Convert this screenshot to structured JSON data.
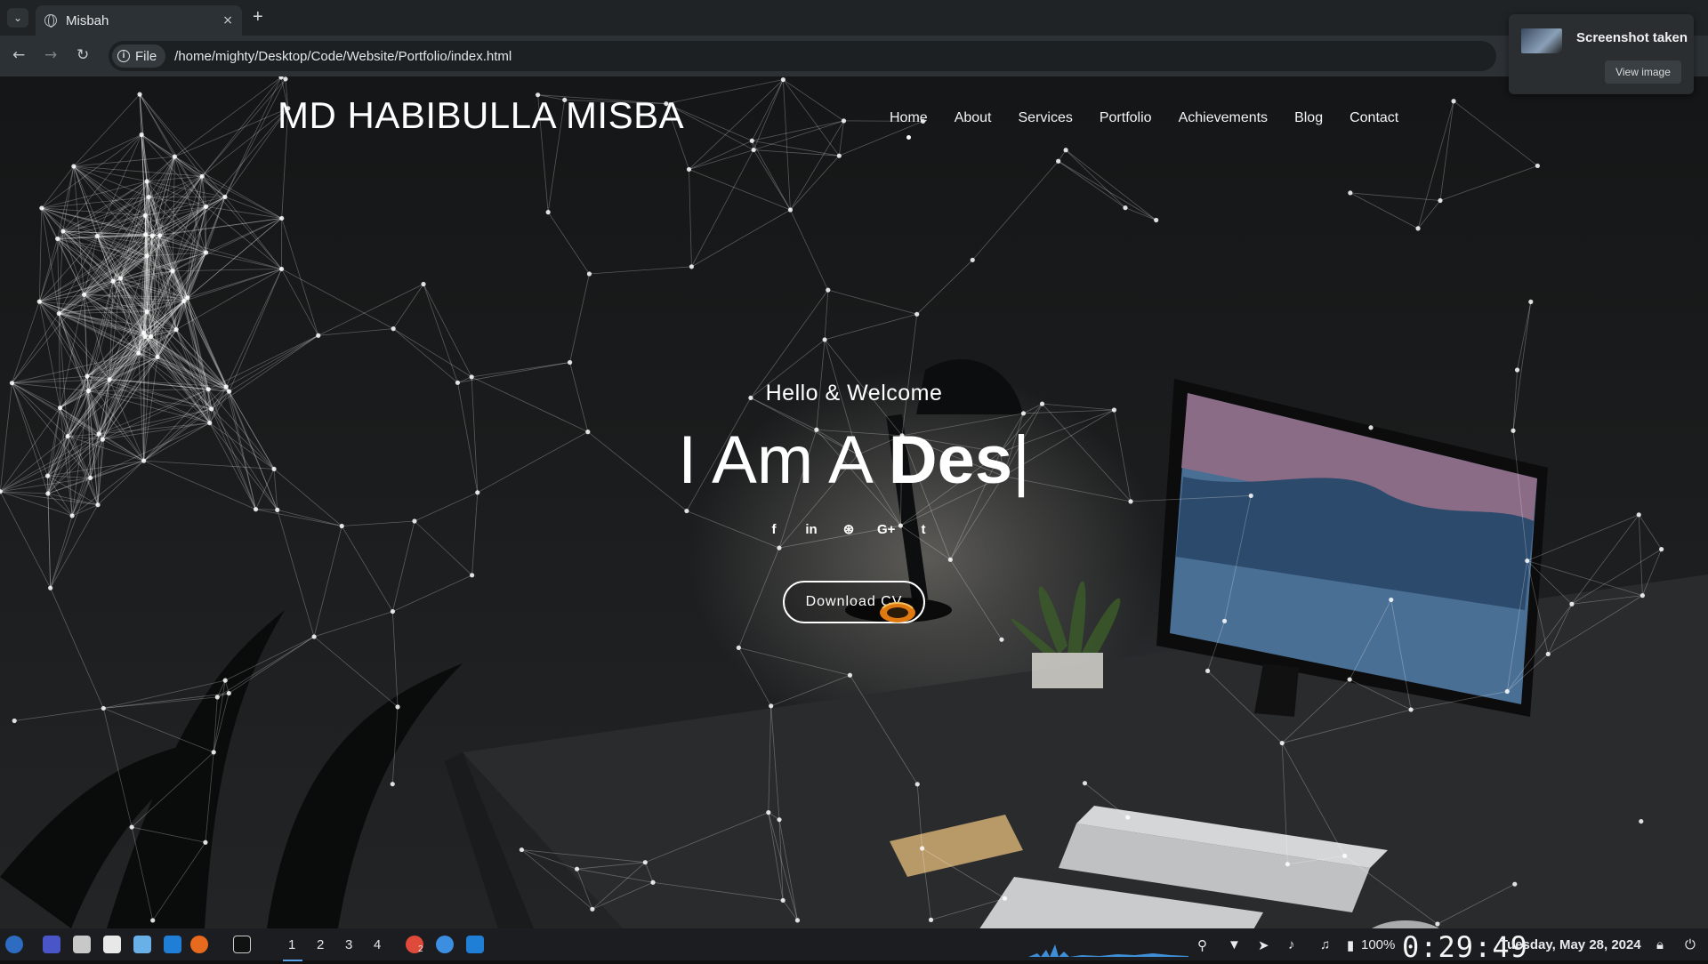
{
  "browser": {
    "tab_title": "Misbah",
    "tab_close": "×",
    "new_tab": "+",
    "back": "←",
    "forward": "→",
    "reload": "↻",
    "chip_label": "File",
    "url": "/home/mighty/Desktop/Code/Website/Portfolio/index.html"
  },
  "site": {
    "brand": "MD HABIBULLA MISBA",
    "nav": [
      {
        "label": "Home"
      },
      {
        "label": "About"
      },
      {
        "label": "Services"
      },
      {
        "label": "Portfolio"
      },
      {
        "label": "Achievements"
      },
      {
        "label": "Blog"
      },
      {
        "label": "Contact"
      }
    ],
    "active_nav": "Home",
    "greeting": "Hello & Welcome",
    "headline_lead": "I Am A ",
    "headline_typed": "Des",
    "headline_caret": "|",
    "socials": [
      "f",
      "in",
      "⊛",
      "G+",
      "t"
    ],
    "social_icons": [
      "facebook-icon",
      "linkedin-icon",
      "dribbble-icon",
      "google-plus-icon",
      "twitter-icon"
    ],
    "cv_button": "Download CV"
  },
  "notification": {
    "title": "Screenshot taken",
    "action": "View image"
  },
  "taskbar": {
    "workspaces": [
      "1",
      "2",
      "3",
      "4"
    ],
    "active_workspace": "1",
    "battery": "100%",
    "clock": "0:29:49",
    "date": "Tuesday, May 28, 2024",
    "badge": "2"
  },
  "colors": {
    "page_bg": "#141617",
    "text": "#ffffff",
    "accent": "#5aa0e6"
  }
}
